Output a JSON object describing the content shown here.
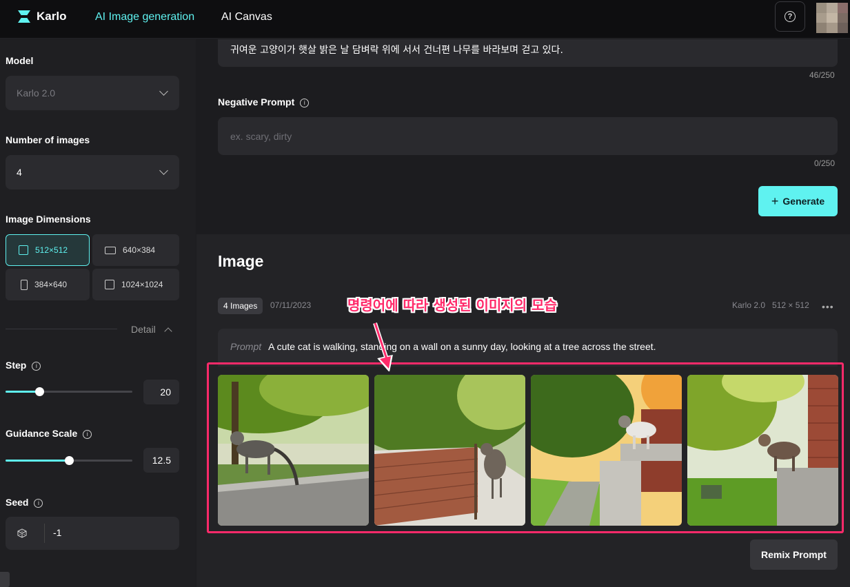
{
  "nav": {
    "brand": "Karlo",
    "links": [
      "AI Image generation",
      "AI Canvas"
    ],
    "help_icon": "help-circle-icon"
  },
  "sidebar": {
    "model": {
      "label": "Model",
      "value": "Karlo 2.0"
    },
    "num_images": {
      "label": "Number of images",
      "value": "4"
    },
    "dimensions": {
      "label": "Image Dimensions",
      "options": [
        "512×512",
        "640×384",
        "384×640",
        "1024×1024"
      ],
      "selected": "512×512"
    },
    "detail_label": "Detail",
    "step": {
      "label": "Step",
      "value": "20",
      "fraction": 0.27
    },
    "guidance": {
      "label": "Guidance Scale",
      "value": "12.5",
      "fraction": 0.5
    },
    "seed": {
      "label": "Seed",
      "value": "-1",
      "icon": "dice-icon"
    }
  },
  "form": {
    "prompt_text": "귀여운 고양이가 햇살 밝은 날 담벼락 위에 서서 건너편 나무를 바라보며 걷고 있다.",
    "prompt_count": "46/250",
    "negative_label": "Negative Prompt",
    "negative_placeholder": "ex. scary, dirty",
    "negative_count": "0/250",
    "generate_label": "Generate"
  },
  "result": {
    "title": "Image",
    "badge": "4 Images",
    "date": "07/11/2023",
    "model": "Karlo 2.0",
    "size": "512 × 512",
    "prompt_label": "Prompt",
    "prompt_text": "A cute cat is walking, standing on a wall on a sunny day, looking at a tree across the street.",
    "remix_label": "Remix Prompt"
  },
  "annotation": {
    "text": "명령어에 따라 생성된 이미지의 모습",
    "color": "#ff2a6a"
  },
  "colors": {
    "accent": "#5ff2f0",
    "annotation": "#ff2a6a"
  }
}
